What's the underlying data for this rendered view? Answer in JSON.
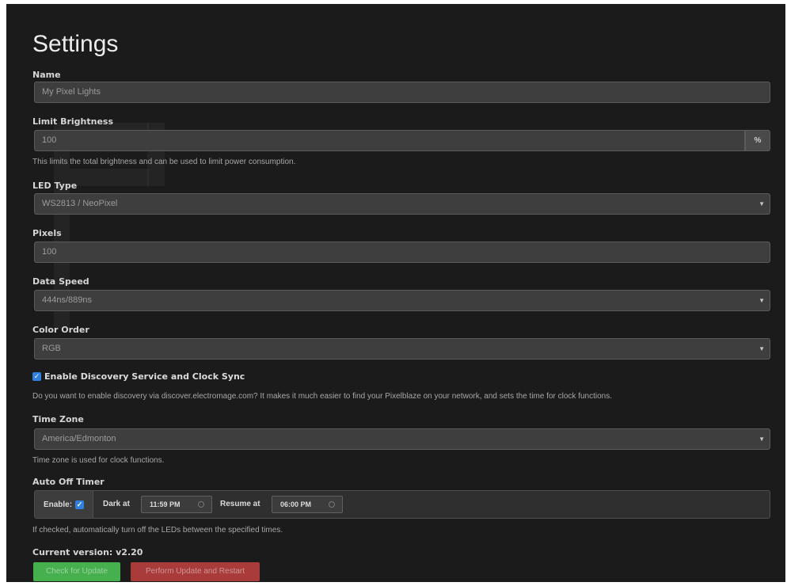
{
  "title": "Settings",
  "fields": {
    "name": {
      "label": "Name",
      "value": "My Pixel Lights"
    },
    "brightness": {
      "label": "Limit Brightness",
      "value": "100",
      "unit": "%",
      "help": "This limits the total brightness and can be used to limit power consumption."
    },
    "led_type": {
      "label": "LED Type",
      "value": "WS2813 / NeoPixel"
    },
    "pixels": {
      "label": "Pixels",
      "value": "100"
    },
    "data_speed": {
      "label": "Data Speed",
      "value": "444ns/889ns"
    },
    "color_order": {
      "label": "Color Order",
      "value": "RGB"
    }
  },
  "discovery": {
    "checked": true,
    "label": "Enable Discovery Service and Clock Sync",
    "help": "Do you want to enable discovery via discover.electromage.com? It makes it much easier to find your Pixelblaze on your network, and sets the time for clock functions."
  },
  "time_zone": {
    "label": "Time Zone",
    "value": "America/Edmonton",
    "help": "Time zone is used for clock functions."
  },
  "auto_off": {
    "label": "Auto Off Timer",
    "enable_label": "Enable:",
    "enabled": true,
    "dark_label": "Dark at",
    "dark_time": "11:59 PM",
    "resume_label": "Resume at",
    "resume_time": "06:00 PM",
    "help": "If checked, automatically turn off the LEDs between the specified times."
  },
  "version": {
    "text": "Current version: v2.20"
  },
  "buttons": {
    "check_update": "Check for Update",
    "perform_update": "Perform Update and Restart"
  },
  "colors": {
    "background": "#1b1b1b",
    "input": "#3e3e3e",
    "success": "#46b04e",
    "danger": "#a93b3b",
    "checkbox": "#2f7fe0"
  },
  "icons": {
    "select_caret": "chevron-down-icon",
    "time_picker": "clock-icon"
  }
}
